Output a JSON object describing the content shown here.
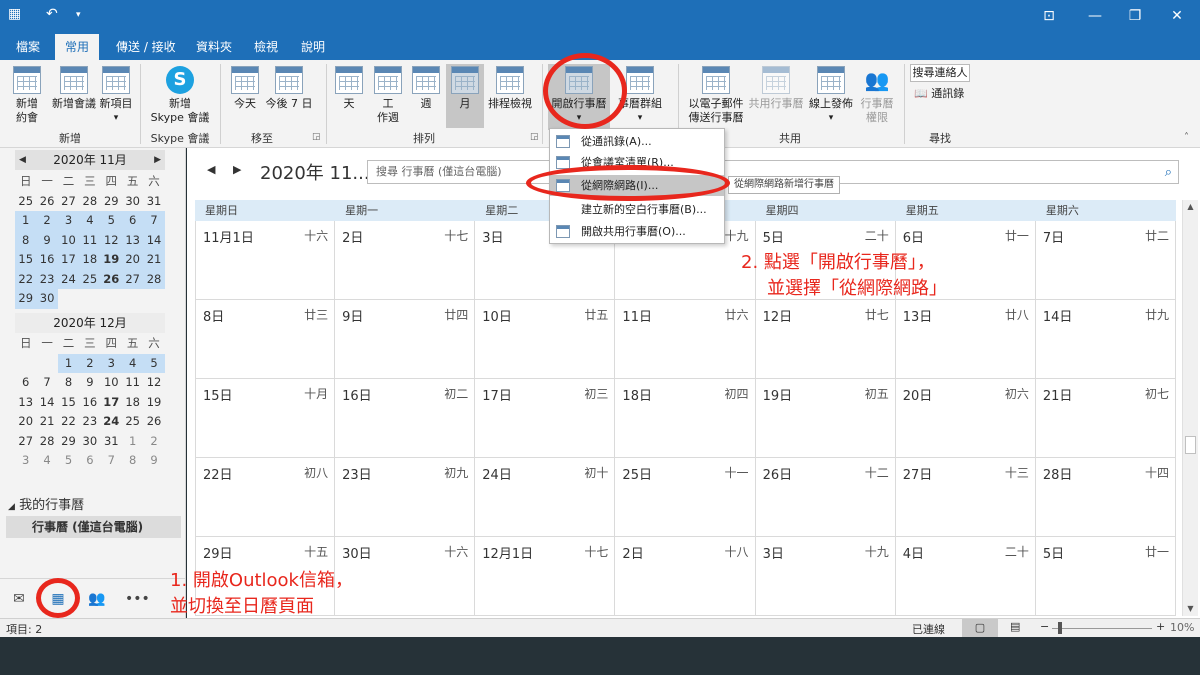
{
  "tabs": [
    "檔案",
    "常用",
    "傳送 / 接收",
    "資料夾",
    "檢視",
    "說明"
  ],
  "ribbon": {
    "new_appt": [
      "新增",
      "約會"
    ],
    "new_meeting": [
      "新增會議"
    ],
    "new_item": [
      "新項目"
    ],
    "skype": [
      "新增",
      "Skype 會議"
    ],
    "today": "今天",
    "next7": "今後 7 日",
    "day": "天",
    "workweek": [
      "工",
      "作週"
    ],
    "week": "週",
    "month": "月",
    "schedule": "排程檢視",
    "open_cal": "開啟行事曆",
    "cal_group": "事曆群組",
    "email_cal": [
      "以電子郵件",
      "傳送行事曆"
    ],
    "share_cal": "共用行事曆",
    "publish": "線上發佈",
    "perm": [
      "行事曆",
      "權限"
    ],
    "search_people": "搜尋連絡人",
    "address_book": "通訊錄",
    "groups": {
      "new": "新增",
      "skype": "Skype 會議",
      "goto": "移至",
      "arrange": "排列",
      "share": "共用",
      "find": "尋找"
    }
  },
  "nav": {
    "mini1": {
      "title": "2020年 11月",
      "dow": [
        "日",
        "一",
        "二",
        "三",
        "四",
        "五",
        "六"
      ],
      "rows": [
        [
          "25",
          "26",
          "27",
          "28",
          "29",
          "30",
          "31"
        ],
        [
          "1",
          "2",
          "3",
          "4",
          "5",
          "6",
          "7"
        ],
        [
          "8",
          "9",
          "10",
          "11",
          "12",
          "13",
          "14"
        ],
        [
          "15",
          "16",
          "17",
          "18",
          "19",
          "20",
          "21"
        ],
        [
          "22",
          "23",
          "24",
          "25",
          "26",
          "27",
          "28"
        ],
        [
          "29",
          "30"
        ]
      ]
    },
    "mini2": {
      "title": "2020年 12月",
      "dow": [
        "日",
        "一",
        "二",
        "三",
        "四",
        "五",
        "六"
      ],
      "rows": [
        [
          "",
          "",
          "1",
          "2",
          "3",
          "4",
          "5"
        ],
        [
          "6",
          "7",
          "8",
          "9",
          "10",
          "11",
          "12"
        ],
        [
          "13",
          "14",
          "15",
          "16",
          "17",
          "18",
          "19"
        ],
        [
          "20",
          "21",
          "22",
          "23",
          "24",
          "25",
          "26"
        ],
        [
          "27",
          "28",
          "29",
          "30",
          "31",
          "1",
          "2"
        ],
        [
          "3",
          "4",
          "5",
          "6",
          "7",
          "8",
          "9"
        ]
      ]
    },
    "my_calendars": "我的行事曆",
    "calendar_item": "行事曆 (僅這台電腦)"
  },
  "main": {
    "month_title": "2020年 11...",
    "search_placeholder": "搜尋 行事曆 (僅這台電腦)",
    "dow": [
      "星期日",
      "星期一",
      "星期二",
      "星期三",
      "星期四",
      "星期五",
      "星期六"
    ],
    "weeks": [
      [
        [
          "11月1日",
          "十六"
        ],
        [
          "2日",
          "十七"
        ],
        [
          "3日",
          ""
        ],
        [
          "",
          "十九"
        ],
        [
          "5日",
          "二十"
        ],
        [
          "6日",
          "廿一"
        ],
        [
          "7日",
          "廿二"
        ]
      ],
      [
        [
          "8日",
          "廿三"
        ],
        [
          "9日",
          "廿四"
        ],
        [
          "10日",
          "廿五"
        ],
        [
          "11日",
          "廿六"
        ],
        [
          "12日",
          "廿七"
        ],
        [
          "13日",
          "廿八"
        ],
        [
          "14日",
          "廿九"
        ]
      ],
      [
        [
          "15日",
          "十月"
        ],
        [
          "16日",
          "初二"
        ],
        [
          "17日",
          "初三"
        ],
        [
          "18日",
          "初四"
        ],
        [
          "19日",
          "初五"
        ],
        [
          "20日",
          "初六"
        ],
        [
          "21日",
          "初七"
        ]
      ],
      [
        [
          "22日",
          "初八"
        ],
        [
          "23日",
          "初九"
        ],
        [
          "24日",
          "初十"
        ],
        [
          "25日",
          "十一"
        ],
        [
          "26日",
          "十二"
        ],
        [
          "27日",
          "十三"
        ],
        [
          "28日",
          "十四"
        ]
      ],
      [
        [
          "29日",
          "十五"
        ],
        [
          "30日",
          "十六"
        ],
        [
          "12月1日",
          "十七"
        ],
        [
          "2日",
          "十八"
        ],
        [
          "3日",
          "十九"
        ],
        [
          "4日",
          "二十"
        ],
        [
          "5日",
          "廿一"
        ]
      ]
    ]
  },
  "dropdown": {
    "items": [
      "從通訊錄(A)...",
      "從會議室清單(R)...",
      "從網際網路(I)...",
      "建立新的空白行事曆(B)...",
      "開啟共用行事曆(O)..."
    ],
    "tooltip": "從網際網路新增行事曆"
  },
  "status": {
    "items": "項目: 2",
    "connected": "已連線",
    "zoom": "10%"
  },
  "annotations": {
    "step1": [
      "1. 開啟Outlook信箱，",
      "並切換至日曆頁面"
    ],
    "step2": [
      "2. 點選「開啟行事曆」，",
      "並選擇「從網際網路」"
    ]
  },
  "colors": {
    "accent": "#1e6fb8",
    "annotation": "#e8271d",
    "selection": "#c5def5"
  }
}
